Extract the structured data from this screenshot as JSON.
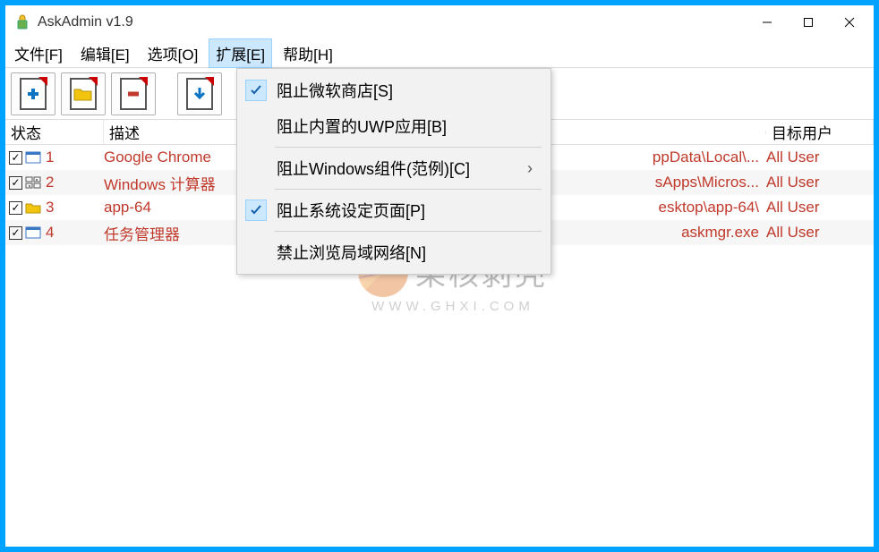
{
  "title": "AskAdmin v1.9",
  "menubar": [
    {
      "label": "文件[F]",
      "open": false
    },
    {
      "label": "编辑[E]",
      "open": false
    },
    {
      "label": "选项[O]",
      "open": false
    },
    {
      "label": "扩展[E]",
      "open": true
    },
    {
      "label": "帮助[H]",
      "open": false
    }
  ],
  "dropdown": {
    "items": [
      {
        "label": "阻止微软商店[S]",
        "checked": true,
        "sep": false,
        "arrow": false
      },
      {
        "label": "阻止内置的UWP应用[B]",
        "checked": false,
        "sep": true,
        "arrow": false
      },
      {
        "label": "阻止Windows组件(范例)[C]",
        "checked": false,
        "sep": true,
        "arrow": true
      },
      {
        "label": "阻止系统设定页面[P]",
        "checked": true,
        "sep": true,
        "arrow": false
      },
      {
        "label": "禁止浏览局域网络[N]",
        "checked": false,
        "sep": false,
        "arrow": false
      }
    ]
  },
  "columns": {
    "status": "状态",
    "desc": "描述",
    "user": "目标用户"
  },
  "rows": [
    {
      "num": "1",
      "icon": "app",
      "desc": "Google Chrome",
      "path": "ppData\\Local\\...",
      "user": "All User"
    },
    {
      "num": "2",
      "icon": "calc",
      "desc": "Windows 计算器",
      "path": "sApps\\Micros...",
      "user": "All User"
    },
    {
      "num": "3",
      "icon": "folder",
      "desc": "app-64",
      "path": "esktop\\app-64\\",
      "user": "All User"
    },
    {
      "num": "4",
      "icon": "app",
      "desc": "任务管理器",
      "path": "askmgr.exe",
      "user": "All User"
    }
  ],
  "watermark": {
    "text": "果核剥壳",
    "url": "WWW.GHXI.COM"
  }
}
